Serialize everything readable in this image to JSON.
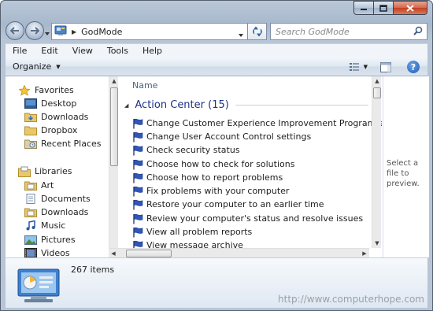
{
  "address": {
    "location": "GodMode"
  },
  "search": {
    "placeholder": "Search GodMode"
  },
  "menu": [
    "File",
    "Edit",
    "View",
    "Tools",
    "Help"
  ],
  "toolbar": {
    "organize_label": "Organize"
  },
  "nav_pane": {
    "favorites": {
      "label": "Favorites",
      "items": [
        "Desktop",
        "Downloads",
        "Dropbox",
        "Recent Places"
      ]
    },
    "libraries": {
      "label": "Libraries",
      "items": [
        "Art",
        "Documents",
        "Downloads",
        "Music",
        "Pictures",
        "Videos"
      ]
    }
  },
  "list": {
    "column_name": "Name",
    "group_title": "Action Center (15)",
    "tasks": [
      "Change Customer Experience Improvement Program settings",
      "Change User Account Control settings",
      "Check security status",
      "Choose how to check for solutions",
      "Choose how to report problems",
      "Fix problems with your computer",
      "Restore your computer to an earlier time",
      "Review your computer's status and resolve issues",
      "View all problem reports",
      "View message archive"
    ]
  },
  "preview": {
    "text": "Select a file to preview."
  },
  "details": {
    "item_count": "267 items"
  },
  "watermark": "http://www.computerhope.com",
  "colors": {
    "group_title": "#1e3287",
    "window_frame": "#b9c7d8",
    "close_button": "#c2401e"
  }
}
